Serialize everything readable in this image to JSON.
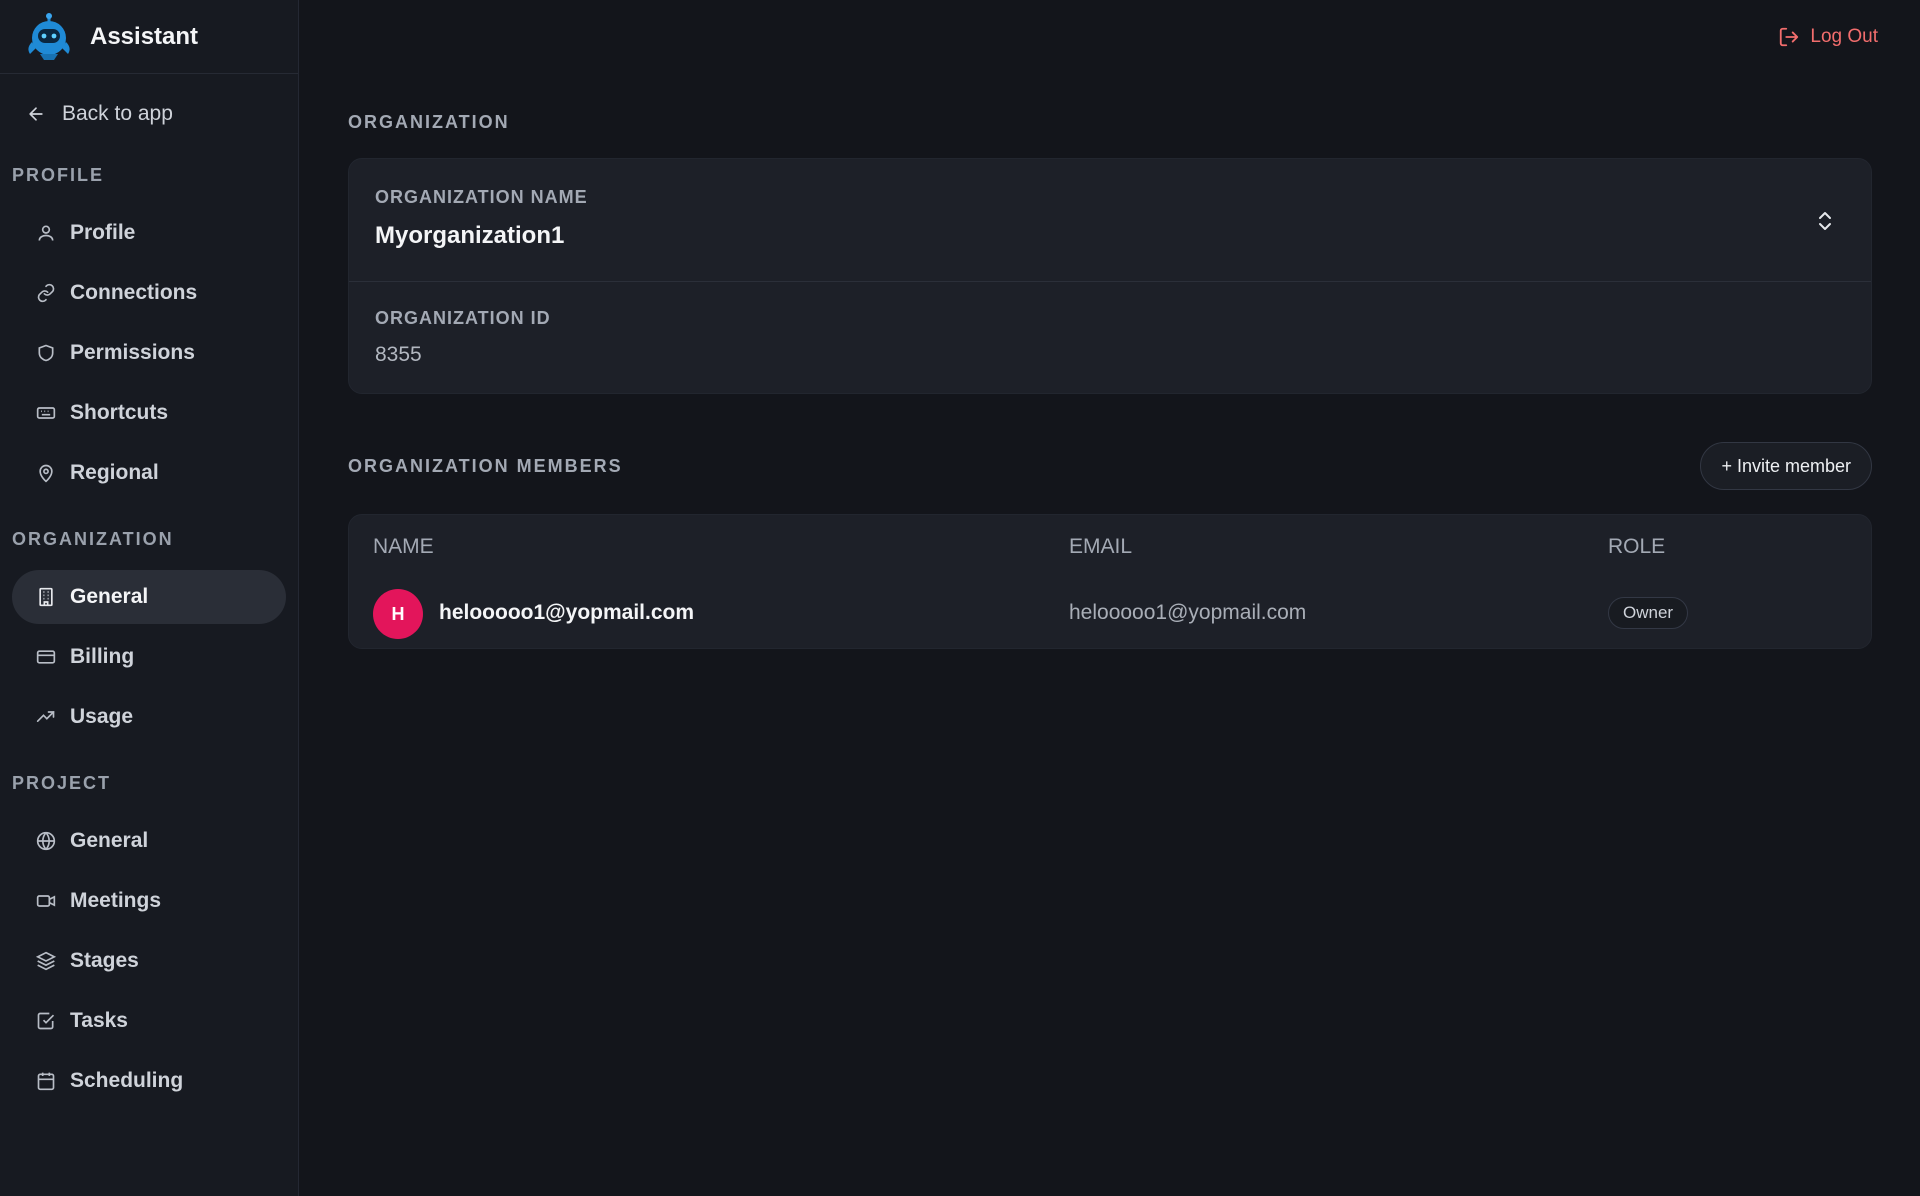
{
  "brand": {
    "name": "Assistant"
  },
  "sidebar": {
    "back_label": "Back to app",
    "sections": [
      {
        "title": "PROFILE",
        "items": [
          {
            "label": "Profile",
            "icon": "user-icon"
          },
          {
            "label": "Connections",
            "icon": "link-icon"
          },
          {
            "label": "Permissions",
            "icon": "shield-icon"
          },
          {
            "label": "Shortcuts",
            "icon": "keyboard-icon"
          },
          {
            "label": "Regional",
            "icon": "map-pin-icon"
          }
        ]
      },
      {
        "title": "ORGANIZATION",
        "items": [
          {
            "label": "General",
            "icon": "building-icon",
            "active": true
          },
          {
            "label": "Billing",
            "icon": "credit-card-icon"
          },
          {
            "label": "Usage",
            "icon": "trending-up-icon"
          }
        ]
      },
      {
        "title": "PROJECT",
        "items": [
          {
            "label": "General",
            "icon": "globe-icon"
          },
          {
            "label": "Meetings",
            "icon": "video-icon"
          },
          {
            "label": "Stages",
            "icon": "layers-icon"
          },
          {
            "label": "Tasks",
            "icon": "check-square-icon"
          },
          {
            "label": "Scheduling",
            "icon": "calendar-icon"
          }
        ]
      }
    ]
  },
  "header": {
    "logout_label": "Log Out"
  },
  "organization": {
    "section_title": "ORGANIZATION",
    "name_label": "ORGANIZATION NAME",
    "name_value": "Myorganization1",
    "id_label": "ORGANIZATION ID",
    "id_value": "8355"
  },
  "members": {
    "section_title": "ORGANIZATION MEMBERS",
    "invite_label": "+ Invite member",
    "columns": {
      "name": "NAME",
      "email": "EMAIL",
      "role": "ROLE"
    },
    "rows": [
      {
        "initial": "H",
        "name": "helooooo1@yopmail.com",
        "email": "helooooo1@yopmail.com",
        "role": "Owner"
      }
    ]
  },
  "colors": {
    "accent_danger": "#f26d6d",
    "avatar": "#e3155b",
    "active_bg": "#2a2e37"
  }
}
